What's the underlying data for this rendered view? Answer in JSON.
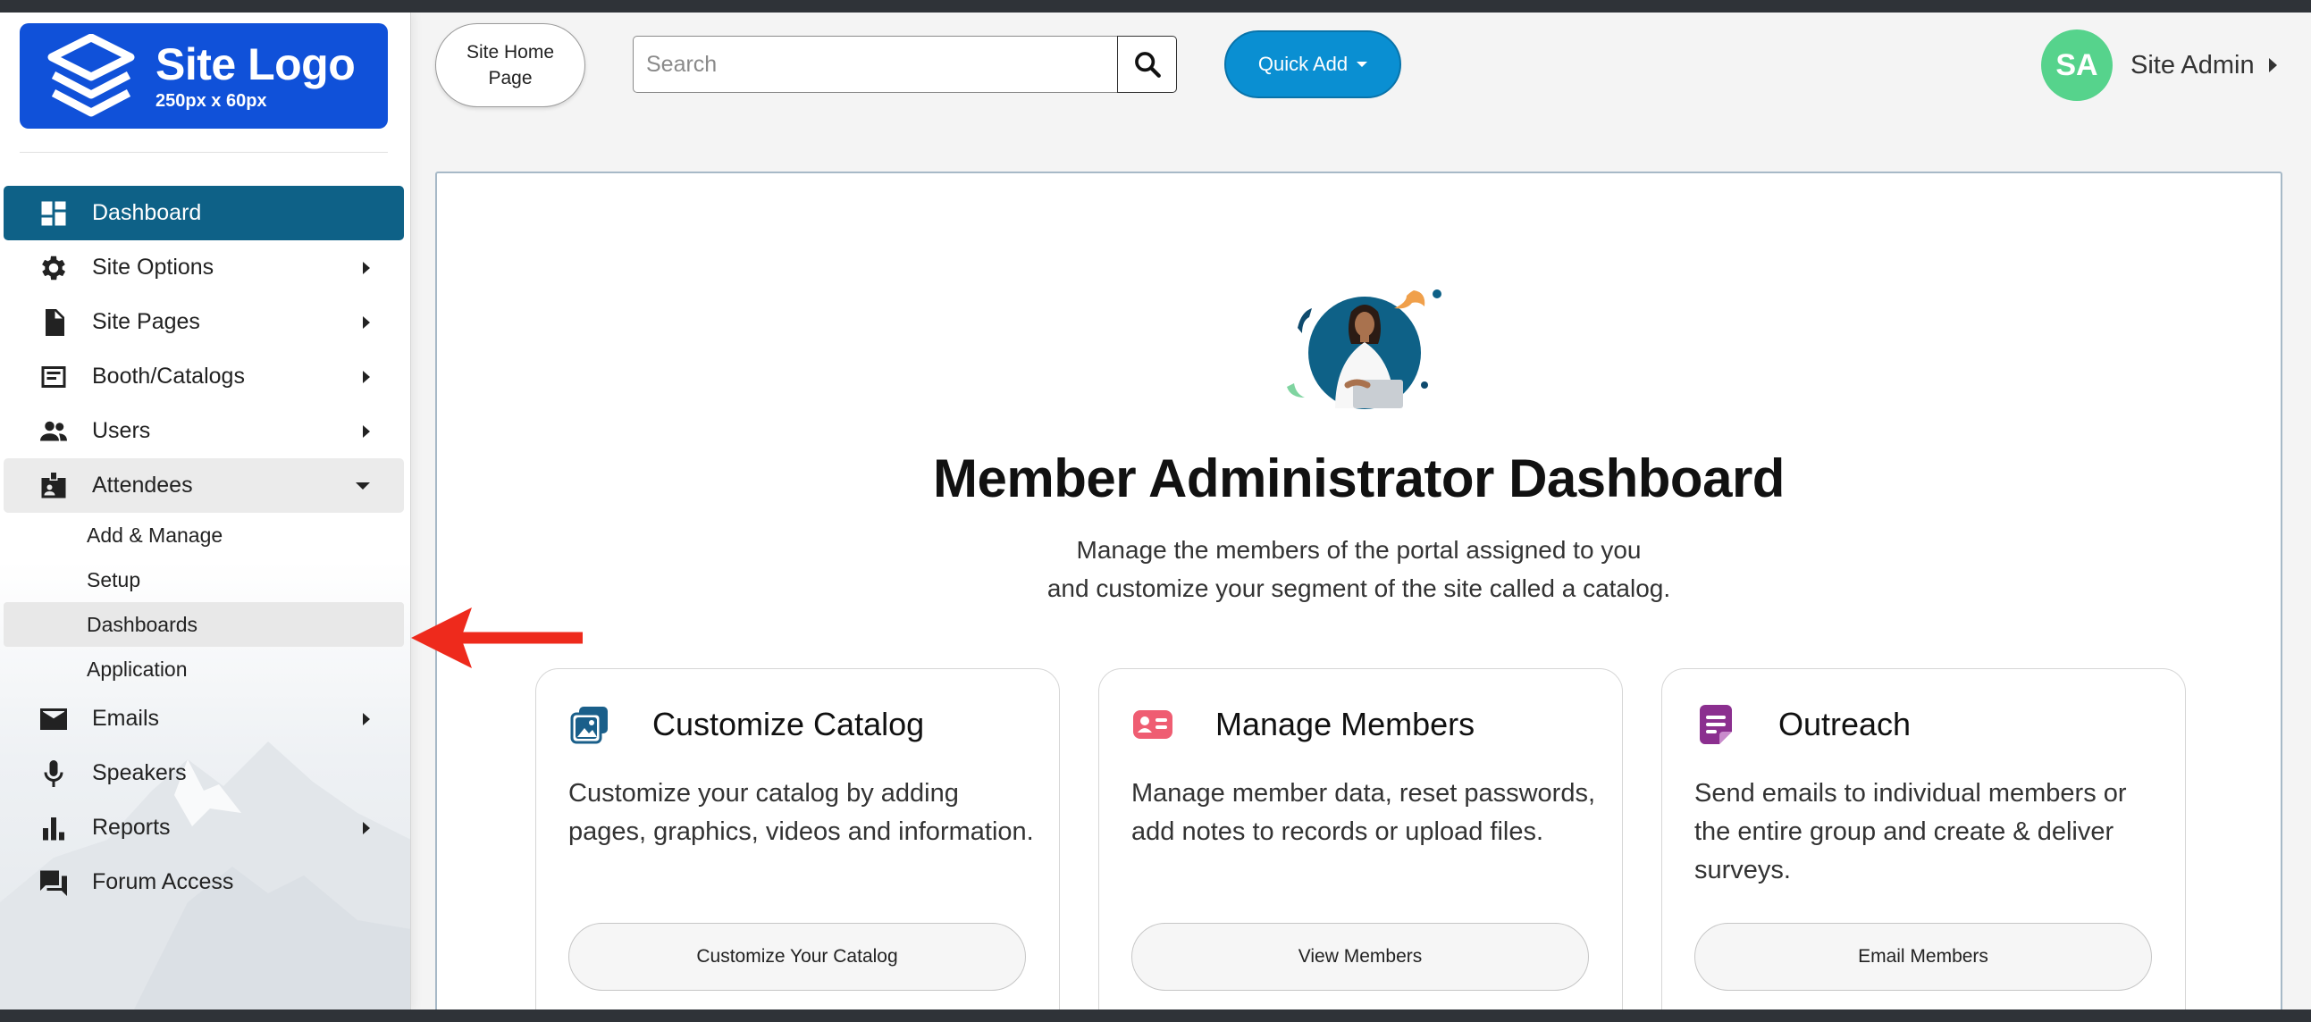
{
  "logo": {
    "title": "Site Logo",
    "subtitle": "250px x 60px"
  },
  "sidebar": {
    "items": [
      {
        "label": "Dashboard",
        "icon": "dashboard-icon",
        "state": "active",
        "caret": ""
      },
      {
        "label": "Site Options",
        "icon": "gear-icon",
        "state": "",
        "caret": "right"
      },
      {
        "label": "Site Pages",
        "icon": "document-icon",
        "state": "",
        "caret": "right"
      },
      {
        "label": "Booth/Catalogs",
        "icon": "catalog-icon",
        "state": "",
        "caret": "right"
      },
      {
        "label": "Users",
        "icon": "people-icon",
        "state": "",
        "caret": "right"
      },
      {
        "label": "Attendees",
        "icon": "badge-icon",
        "state": "open",
        "caret": "down"
      },
      {
        "label": "Emails",
        "icon": "envelope-icon",
        "state": "",
        "caret": "right"
      },
      {
        "label": "Speakers",
        "icon": "microphone-icon",
        "state": "",
        "caret": ""
      },
      {
        "label": "Reports",
        "icon": "bar-chart-icon",
        "state": "",
        "caret": "right"
      },
      {
        "label": "Forum Access",
        "icon": "forum-icon",
        "state": "",
        "caret": ""
      }
    ],
    "attendees_sub": [
      "Add & Manage",
      "Setup",
      "Dashboards",
      "Application"
    ],
    "highlighted_sub": "Dashboards"
  },
  "topbar": {
    "home_button": "Site Home Page",
    "search_placeholder": "Search",
    "quick_add": "Quick Add",
    "user_initials": "SA",
    "user_name": "Site Admin"
  },
  "main": {
    "title": "Member Administrator Dashboard",
    "subtitle_line1": "Manage the members of the portal assigned to you",
    "subtitle_line2": "and customize your segment of the site called a catalog.",
    "cards": [
      {
        "title": "Customize Catalog",
        "description": "Customize your catalog by adding pages, graphics, videos and information.",
        "button": "Customize Your Catalog",
        "icon": "image-gallery-icon",
        "color": "#1a5f8a"
      },
      {
        "title": "Manage Members",
        "description": "Manage member data, reset passwords, add notes to records or upload files.",
        "button": "View Members",
        "icon": "member-card-icon",
        "color": "#ef5d72"
      },
      {
        "title": "Outreach",
        "description": "Send emails to individual members or the entire group and create & deliver surveys.",
        "button": "Email Members",
        "icon": "note-icon",
        "color": "#8b2f8f"
      }
    ]
  },
  "colors": {
    "logo_bg": "#1051d9",
    "active_nav": "#0e6187",
    "quick_add": "#0a8fd2",
    "avatar": "#56d38c",
    "annotation_arrow": "#ee2a1c"
  }
}
